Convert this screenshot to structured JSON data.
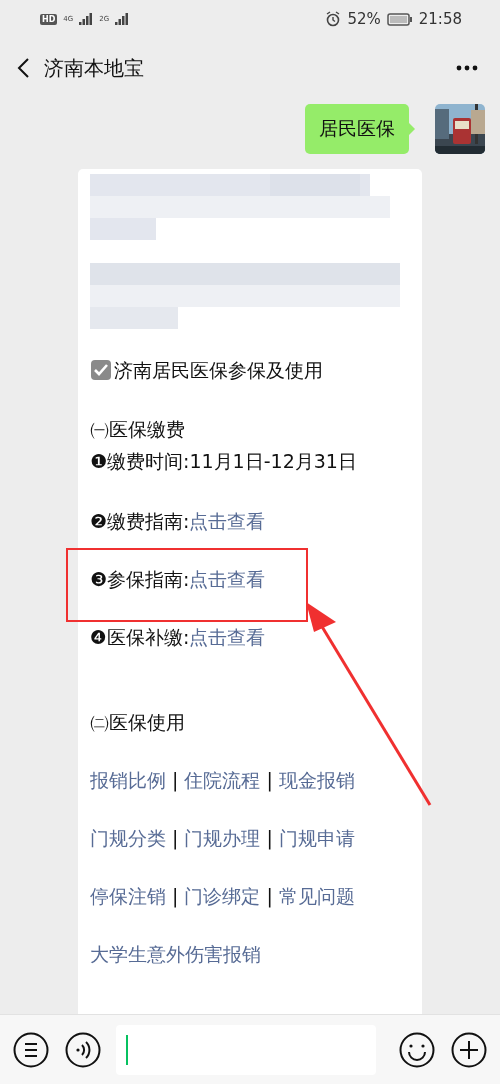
{
  "status_bar": {
    "hd": "HD",
    "networks": [
      "4G",
      "2G"
    ],
    "battery_percent": "52%",
    "time": "21:58"
  },
  "header": {
    "title": "济南本地宝"
  },
  "messages": [
    {
      "kind": "sent",
      "text": "居民医保"
    },
    {
      "kind": "card",
      "title": "济南居民医保参保及使用",
      "sections": [
        {
          "heading": "㈠医保缴费",
          "lines": [
            {
              "kind": "text",
              "text": "❶缴费时间:11月1日-12月31日"
            },
            {
              "kind": "label_link",
              "label": "❷缴费指南:",
              "link": "点击查看"
            },
            {
              "kind": "label_link",
              "label": "❸参保指南:",
              "link": "点击查看"
            },
            {
              "kind": "label_link",
              "label": "❹医保补缴:",
              "link": "点击查看"
            }
          ]
        },
        {
          "heading": "㈡医保使用",
          "lines": [
            {
              "kind": "links",
              "separator": "|",
              "links": [
                "报销比例",
                "住院流程",
                "现金报销"
              ]
            },
            {
              "kind": "links",
              "separator": "|",
              "links": [
                "门规分类",
                "门规办理",
                "门规申请"
              ]
            },
            {
              "kind": "links",
              "separator": "|",
              "links": [
                "停保注销",
                "门诊绑定",
                "常见问题"
              ]
            },
            {
              "kind": "links",
              "links": [
                "大学生意外伤害报销"
              ]
            }
          ]
        }
      ]
    }
  ],
  "input_bar": {
    "focused": true
  }
}
